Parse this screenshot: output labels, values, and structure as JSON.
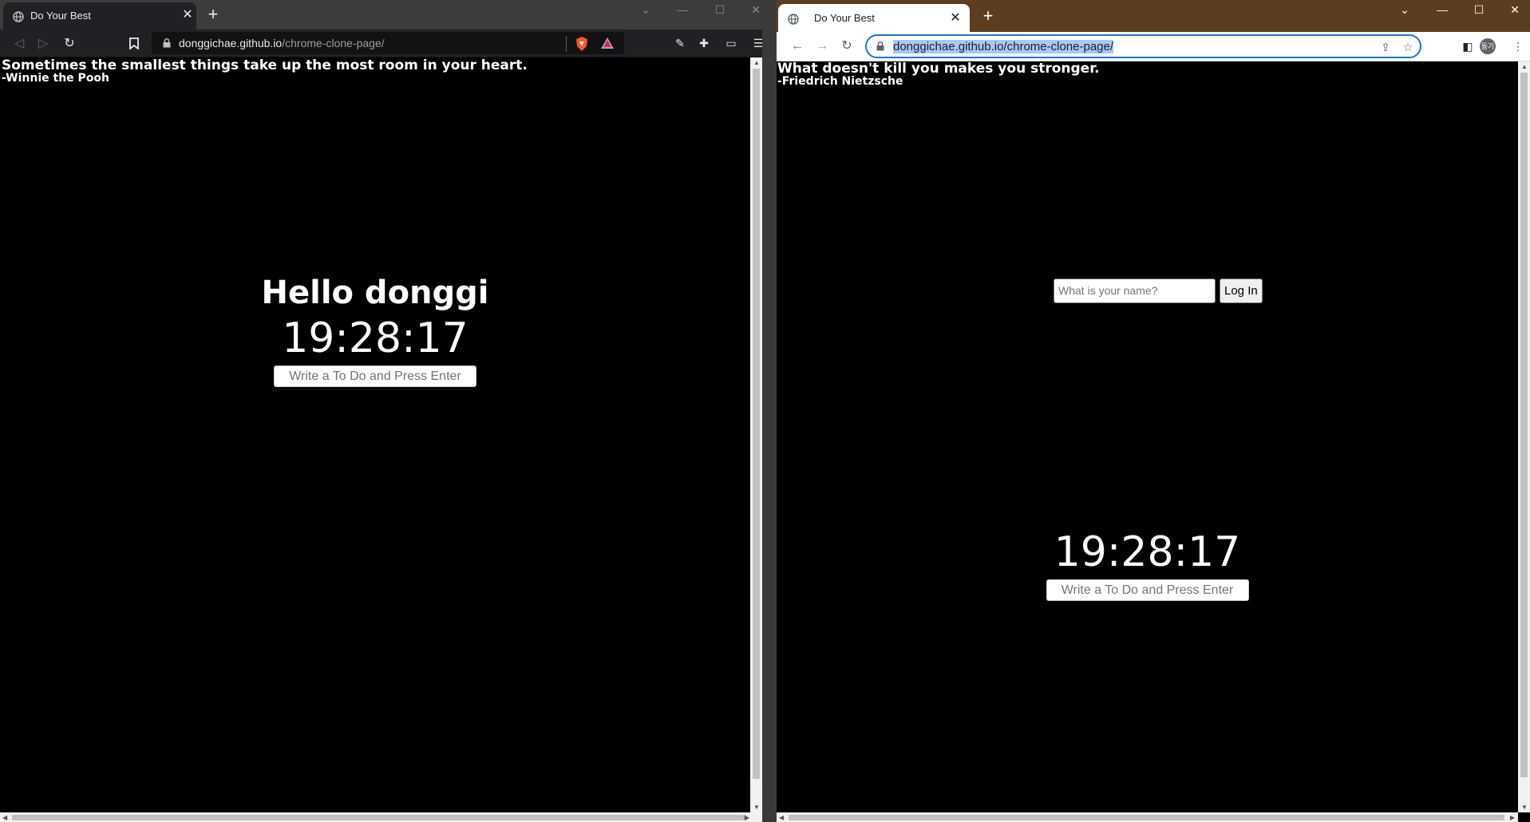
{
  "left_window": {
    "tab": {
      "title": "Do Your Best"
    },
    "address": {
      "host": "donggichae.github.io",
      "path": "/chrome-clone-page/"
    },
    "page": {
      "quote": {
        "text": "Sometimes the smallest things take up the most room in your heart.",
        "author": "-Winnie the Pooh"
      },
      "greeting": "Hello donggi",
      "clock": "19:28:17",
      "todo_placeholder": "Write a To Do and Press Enter"
    }
  },
  "right_window": {
    "tab": {
      "title": "Do Your Best"
    },
    "address": {
      "url": "donggichae.github.io/chrome-clone-page/"
    },
    "profile_initial": "동기",
    "page": {
      "quote": {
        "text": "What doesn't kill you makes you stronger.",
        "author": "-Friedrich Nietzsche"
      },
      "login_placeholder": "What is your name?",
      "login_button": "Log In",
      "clock": "19:28:17",
      "todo_placeholder": "Write a To Do and Press Enter"
    }
  },
  "colors": {
    "left_chrome_bg": "#3c3c3c",
    "left_toolbar_bg": "#202124",
    "right_tabstrip_bg": "#5c3d20",
    "page_bg": "#000000",
    "url_highlight": "#a8c7fa",
    "focus_ring": "#1a73e8"
  },
  "icons": {
    "left_toolbar": [
      "back-icon",
      "forward-icon",
      "reload-icon",
      "bookmark-icon",
      "lock-icon",
      "brave-shield-icon",
      "brave-rewards-icon",
      "sidebar-toggle-icon",
      "extensions-icon",
      "wallet-icon",
      "menu-icon"
    ],
    "right_toolbar": [
      "back-icon",
      "forward-icon",
      "reload-icon",
      "lock-icon",
      "share-icon",
      "star-icon",
      "side-panel-icon",
      "profile-avatar",
      "menu-icon"
    ]
  }
}
